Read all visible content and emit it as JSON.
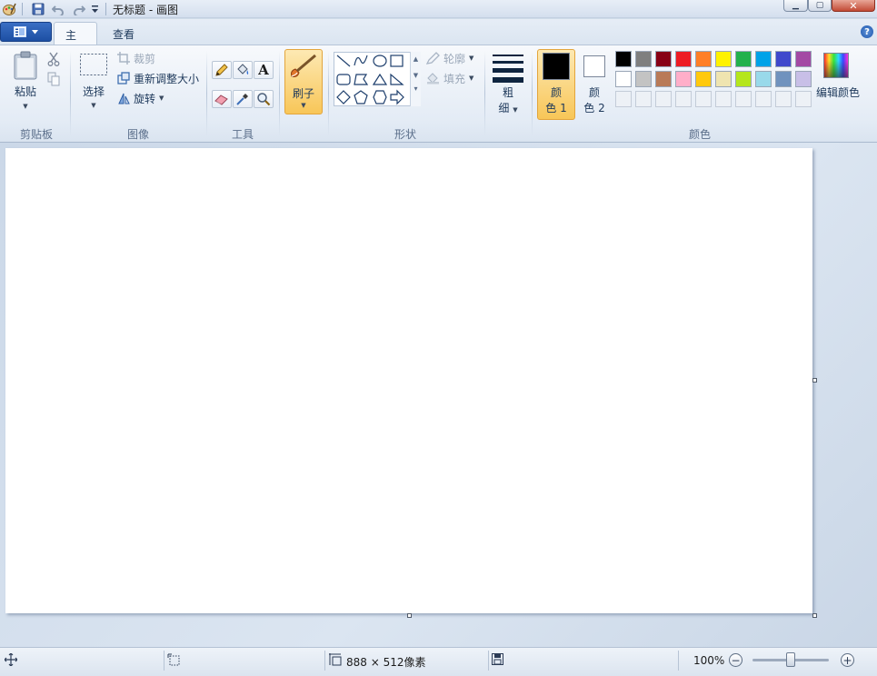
{
  "titlebar": {
    "title": "无标题 - 画图",
    "icons": [
      "paint-app-icon",
      "save-icon",
      "undo-icon",
      "redo-icon",
      "customize-quick-access-icon"
    ],
    "controls": [
      "minimize",
      "maximize",
      "close"
    ]
  },
  "tabs": [
    {
      "label": "主页",
      "active": true
    },
    {
      "label": "查看",
      "active": false
    }
  ],
  "ribbon": {
    "clipboard": {
      "group_label": "剪贴板",
      "paste_label": "粘贴",
      "cut_icon": "scissors-icon",
      "copy_icon": "copy-icon"
    },
    "image": {
      "group_label": "图像",
      "select_label": "选择",
      "crop_label": "裁剪",
      "resize_label": "重新调整大小",
      "rotate_label": "旋转"
    },
    "tools": {
      "group_label": "工具",
      "items": [
        "pencil-icon",
        "fill-bucket-icon",
        "text-icon",
        "eraser-icon",
        "color-picker-icon",
        "magnifier-icon"
      ],
      "text_glyph": "A"
    },
    "brushes": {
      "label": "刷子"
    },
    "shapes": {
      "group_label": "形状",
      "outline_label": "轮廓",
      "fill_label": "填充"
    },
    "size": {
      "label_line1": "粗",
      "label_line2": "细"
    },
    "colors": {
      "group_label": "颜色",
      "color1_line1": "颜",
      "color1_line2": "色 1",
      "color2_line1": "颜",
      "color2_line2": "色 2",
      "color1_value": "#000000",
      "color2_value": "#ffffff",
      "palette_row1": [
        "#000000",
        "#7f7f7f",
        "#880015",
        "#ed1c24",
        "#ff7f27",
        "#fff200",
        "#22b14c",
        "#00a2e8",
        "#3f48cc",
        "#a349a4"
      ],
      "palette_row2": [
        "#ffffff",
        "#c3c3c3",
        "#b97a57",
        "#ffaec9",
        "#ffc90e",
        "#efe4b0",
        "#b5e61d",
        "#99d9ea",
        "#7092be",
        "#c8bfe7"
      ],
      "edit_colors_label": "编辑颜色"
    }
  },
  "status": {
    "canvas_size": "888 × 512像素",
    "zoom": "100%",
    "zoom_out": "−",
    "zoom_in": "+"
  }
}
